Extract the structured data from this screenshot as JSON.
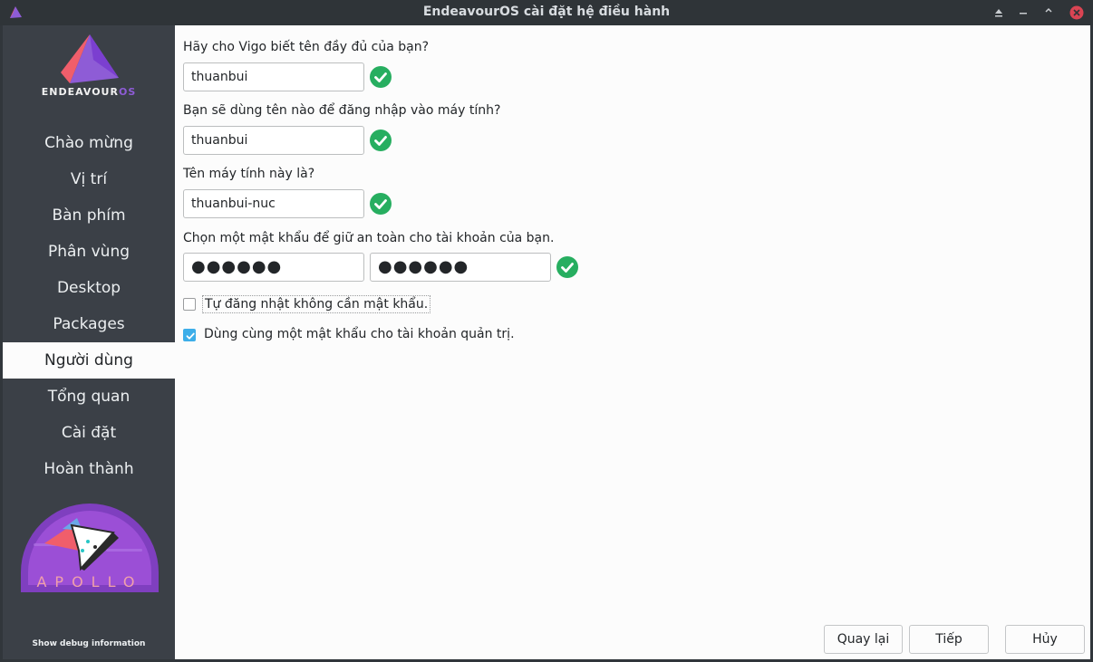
{
  "window": {
    "title": "EndeavourOS cài đặt hệ điều hành"
  },
  "sidebar": {
    "logo_text_main": "ENDEAVOUR",
    "logo_text_accent": "OS",
    "items": [
      {
        "label": "Chào mừng",
        "active": false
      },
      {
        "label": "Vị trí",
        "active": false
      },
      {
        "label": "Bàn phím",
        "active": false
      },
      {
        "label": "Phân vùng",
        "active": false
      },
      {
        "label": "Desktop",
        "active": false
      },
      {
        "label": "Packages",
        "active": false
      },
      {
        "label": "Người dùng",
        "active": true
      },
      {
        "label": "Tổng quan",
        "active": false
      },
      {
        "label": "Cài đặt",
        "active": false
      },
      {
        "label": "Hoàn thành",
        "active": false
      }
    ],
    "badge_text": "APOLLO",
    "debug_label": "Show debug information"
  },
  "form": {
    "fullname_label": "Hãy cho Vigo biết tên đầy đủ của bạn?",
    "fullname_value": "thuanbui",
    "username_label": "Bạn sẽ dùng tên nào để đăng nhập vào máy tính?",
    "username_value": "thuanbui",
    "hostname_label": "Tên máy tính này là?",
    "hostname_value": "thuanbui-nuc",
    "password_label": "Chọn một mật khẩu để giữ an toàn cho tài khoản của bạn.",
    "password_value": "●●●●●●",
    "password_confirm_value": "●●●●●●",
    "autologin_label": "Tự đăng nhật không cần mật khẩu.",
    "autologin_checked": false,
    "same_admin_pw_label": "Dùng cùng một mật khẩu cho tài khoản quản trị.",
    "same_admin_pw_checked": true
  },
  "buttons": {
    "back": "Quay lại",
    "next": "Tiếp",
    "cancel": "Hủy"
  },
  "colors": {
    "sidebar_bg": "#3b4047",
    "titlebar_bg": "#2f3438",
    "valid_green": "#27ae60",
    "checkbox_blue": "#3daee9",
    "close_red": "#da4453"
  }
}
